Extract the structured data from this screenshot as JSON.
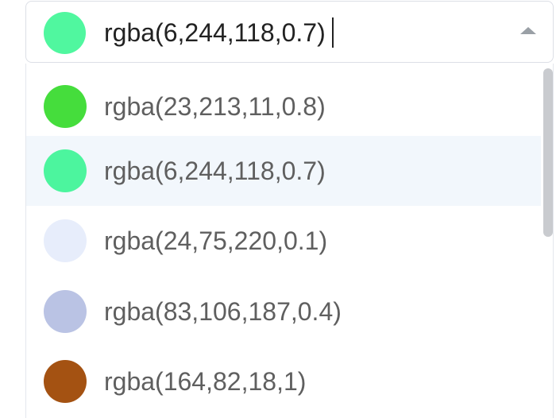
{
  "combobox": {
    "value": "rgba(6,244,118,0.7)",
    "swatch_color": "rgba(6,244,118,0.7)",
    "toggle_icon": "chevron-up-icon"
  },
  "dropdown": {
    "options": [
      {
        "label": "rgba(23,213,11,0.8)",
        "color": "rgba(23,213,11,0.8)",
        "selected": false
      },
      {
        "label": "rgba(6,244,118,0.7)",
        "color": "rgba(6,244,118,0.7)",
        "selected": true
      },
      {
        "label": "rgba(24,75,220,0.1)",
        "color": "rgba(24,75,220,0.1)",
        "selected": false
      },
      {
        "label": "rgba(83,106,187,0.4)",
        "color": "rgba(83,106,187,0.4)",
        "selected": false
      },
      {
        "label": "rgba(164,82,18,1)",
        "color": "rgba(164,82,18,1)",
        "selected": false
      }
    ]
  }
}
